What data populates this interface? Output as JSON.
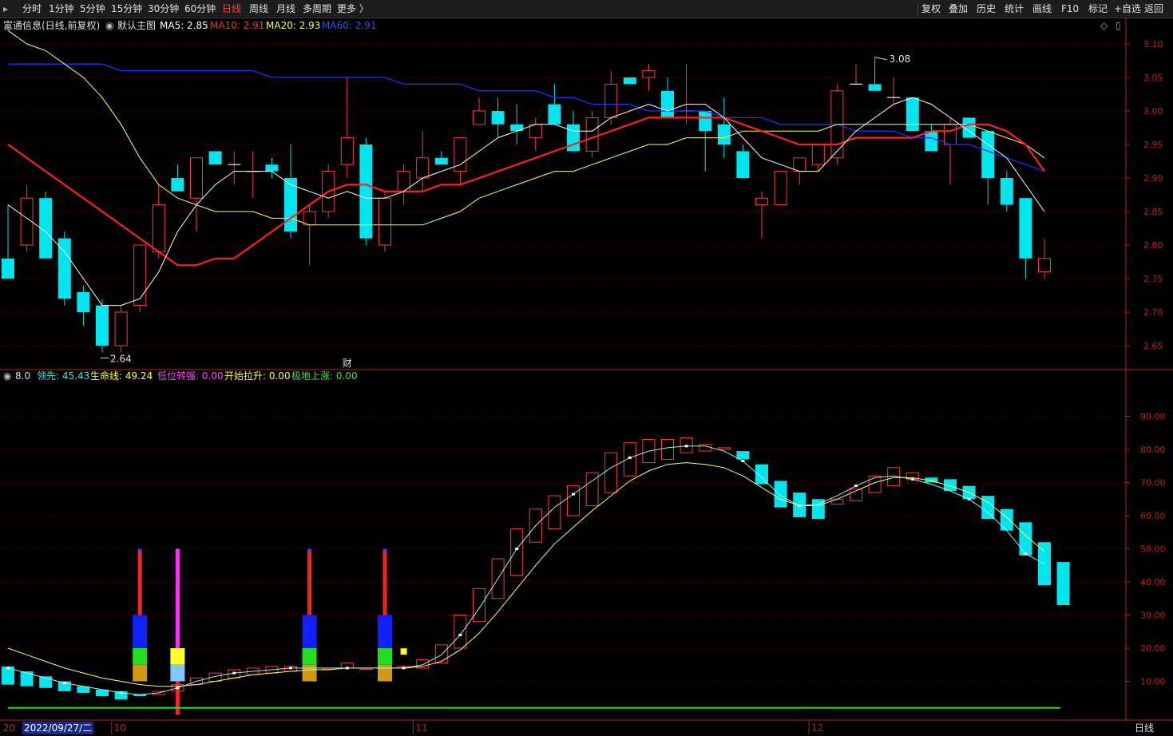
{
  "toolbar": {
    "left": [
      "分时",
      "1分钟",
      "5分钟",
      "15分钟",
      "30分钟",
      "60分钟",
      "日线",
      "周线",
      "月线",
      "多周期",
      "更多 〉"
    ],
    "active": "日线",
    "right": [
      "复权",
      "叠加",
      "历史",
      "统计",
      "画线",
      "F10",
      "标记",
      "+自选",
      "返回"
    ]
  },
  "main_header": {
    "stock": "富通信息(日线,前复权)",
    "indicator": "默认主图",
    "ma5": "MA5: 2.85",
    "ma10": "MA10: 2.91",
    "ma20": "MA20: 2.93",
    "ma60": "MA60: 2.91"
  },
  "sub_header": {
    "param": "8.0",
    "lead": "领先: 45.43",
    "life": "生命线: 49.24",
    "low_strong": "低位转强: 0.00",
    "pull_up": "开始拉升: 0.00",
    "extreme_rise": "极地上涨: 0.00"
  },
  "annotations": {
    "high": "3.08",
    "low": "2.64",
    "finance": "财"
  },
  "x_axis": {
    "date_box": "2022/09/27/二",
    "prefix": "20",
    "months": [
      {
        "label": "10",
        "i": 6
      },
      {
        "label": "11",
        "i": 22
      },
      {
        "label": "12",
        "i": 43
      }
    ],
    "period_label": "日线"
  },
  "colors": {
    "up": "#ff3b3b",
    "down": "#00e5ee",
    "ma5": "#ffffff",
    "ma10": "#ff2020",
    "ma20": "#ffff60",
    "ma60": "#2030ff",
    "grid": "#7a0000",
    "axis": "#c02020"
  },
  "chart_data": [
    {
      "type": "candlestick",
      "title": "富通信息(日线,前复权)",
      "y_ticks": [
        "3.10",
        "3.05",
        "3.00",
        "2.95",
        "2.90",
        "2.85",
        "2.80",
        "2.75",
        "2.70",
        "2.65"
      ],
      "ylim": [
        2.625,
        3.125
      ],
      "candles": [
        {
          "o": 2.78,
          "h": 2.86,
          "l": 2.76,
          "c": 2.75
        },
        {
          "o": 2.8,
          "h": 2.89,
          "l": 2.79,
          "c": 2.87
        },
        {
          "o": 2.87,
          "h": 2.88,
          "l": 2.78,
          "c": 2.78
        },
        {
          "o": 2.81,
          "h": 2.82,
          "l": 2.71,
          "c": 2.72
        },
        {
          "o": 2.73,
          "h": 2.74,
          "l": 2.68,
          "c": 2.7
        },
        {
          "o": 2.71,
          "h": 2.72,
          "l": 2.64,
          "c": 2.65
        },
        {
          "o": 2.65,
          "h": 2.71,
          "l": 2.64,
          "c": 2.7
        },
        {
          "o": 2.71,
          "h": 2.8,
          "l": 2.7,
          "c": 2.8
        },
        {
          "o": 2.79,
          "h": 2.89,
          "l": 2.78,
          "c": 2.86
        },
        {
          "o": 2.9,
          "h": 2.92,
          "l": 2.88,
          "c": 2.88
        },
        {
          "o": 2.87,
          "h": 2.93,
          "l": 2.82,
          "c": 2.93
        },
        {
          "o": 2.94,
          "h": 2.94,
          "l": 2.92,
          "c": 2.92
        },
        {
          "o": 2.92,
          "h": 2.94,
          "l": 2.89,
          "c": 2.92
        },
        {
          "o": 2.91,
          "h": 2.94,
          "l": 2.87,
          "c": 2.91
        },
        {
          "o": 2.92,
          "h": 2.93,
          "l": 2.9,
          "c": 2.91
        },
        {
          "o": 2.9,
          "h": 2.95,
          "l": 2.81,
          "c": 2.82
        },
        {
          "o": 2.83,
          "h": 2.86,
          "l": 2.77,
          "c": 2.85
        },
        {
          "o": 2.85,
          "h": 2.92,
          "l": 2.84,
          "c": 2.91
        },
        {
          "o": 2.92,
          "h": 3.05,
          "l": 2.9,
          "c": 2.96
        },
        {
          "o": 2.95,
          "h": 2.96,
          "l": 2.8,
          "c": 2.81
        },
        {
          "o": 2.8,
          "h": 2.88,
          "l": 2.79,
          "c": 2.87
        },
        {
          "o": 2.88,
          "h": 2.92,
          "l": 2.86,
          "c": 2.91
        },
        {
          "o": 2.9,
          "h": 2.97,
          "l": 2.88,
          "c": 2.93
        },
        {
          "o": 2.93,
          "h": 2.94,
          "l": 2.92,
          "c": 2.92
        },
        {
          "o": 2.91,
          "h": 2.96,
          "l": 2.89,
          "c": 2.96
        },
        {
          "o": 2.98,
          "h": 3.02,
          "l": 2.98,
          "c": 3.0
        },
        {
          "o": 3.0,
          "h": 3.02,
          "l": 2.96,
          "c": 2.98
        },
        {
          "o": 2.98,
          "h": 3.01,
          "l": 2.95,
          "c": 2.97
        },
        {
          "o": 2.96,
          "h": 2.99,
          "l": 2.94,
          "c": 2.98
        },
        {
          "o": 3.01,
          "h": 3.04,
          "l": 2.98,
          "c": 2.98
        },
        {
          "o": 2.98,
          "h": 3.0,
          "l": 2.94,
          "c": 2.94
        },
        {
          "o": 2.94,
          "h": 3.0,
          "l": 2.93,
          "c": 2.99
        },
        {
          "o": 2.99,
          "h": 3.06,
          "l": 2.98,
          "c": 3.04
        },
        {
          "o": 3.05,
          "h": 3.05,
          "l": 3.04,
          "c": 3.04
        },
        {
          "o": 3.05,
          "h": 3.07,
          "l": 3.03,
          "c": 3.06
        },
        {
          "o": 3.03,
          "h": 3.05,
          "l": 2.99,
          "c": 2.99
        },
        {
          "o": 3.0,
          "h": 3.07,
          "l": 2.98,
          "c": 3.0
        },
        {
          "o": 3.0,
          "h": 3.0,
          "l": 2.91,
          "c": 2.97
        },
        {
          "o": 2.98,
          "h": 3.02,
          "l": 2.93,
          "c": 2.95
        },
        {
          "o": 2.94,
          "h": 2.95,
          "l": 2.9,
          "c": 2.9
        },
        {
          "o": 2.86,
          "h": 2.88,
          "l": 2.81,
          "c": 2.87
        },
        {
          "o": 2.86,
          "h": 2.91,
          "l": 2.86,
          "c": 2.91
        },
        {
          "o": 2.91,
          "h": 2.93,
          "l": 2.89,
          "c": 2.93
        },
        {
          "o": 2.92,
          "h": 2.95,
          "l": 2.91,
          "c": 2.95
        },
        {
          "o": 2.93,
          "h": 3.04,
          "l": 2.92,
          "c": 3.03
        },
        {
          "o": 3.04,
          "h": 3.07,
          "l": 3.04,
          "c": 3.04
        },
        {
          "o": 3.04,
          "h": 3.08,
          "l": 3.03,
          "c": 3.03
        },
        {
          "o": 3.02,
          "h": 3.05,
          "l": 3.01,
          "c": 3.02
        },
        {
          "o": 3.02,
          "h": 3.02,
          "l": 2.97,
          "c": 2.97
        },
        {
          "o": 2.97,
          "h": 2.98,
          "l": 2.94,
          "c": 2.94
        },
        {
          "o": 2.95,
          "h": 2.99,
          "l": 2.89,
          "c": 2.98
        },
        {
          "o": 2.99,
          "h": 2.99,
          "l": 2.96,
          "c": 2.96
        },
        {
          "o": 2.97,
          "h": 2.97,
          "l": 2.86,
          "c": 2.9
        },
        {
          "o": 2.9,
          "h": 2.91,
          "l": 2.85,
          "c": 2.86
        },
        {
          "o": 2.87,
          "h": 2.87,
          "l": 2.75,
          "c": 2.78
        },
        {
          "o": 2.76,
          "h": 2.81,
          "l": 2.75,
          "c": 2.78
        }
      ],
      "ma5": [
        2.86,
        2.84,
        2.82,
        2.79,
        2.75,
        2.71,
        2.71,
        2.72,
        2.76,
        2.82,
        2.86,
        2.89,
        2.91,
        2.91,
        2.91,
        2.89,
        2.88,
        2.87,
        2.88,
        2.87,
        2.87,
        2.88,
        2.9,
        2.91,
        2.92,
        2.94,
        2.96,
        2.97,
        2.98,
        2.98,
        2.97,
        2.97,
        2.99,
        3.0,
        3.01,
        3.0,
        3.01,
        3.01,
        2.99,
        2.96,
        2.93,
        2.92,
        2.91,
        2.91,
        2.94,
        2.97,
        2.99,
        3.01,
        3.02,
        3.01,
        2.99,
        2.97,
        2.95,
        2.93,
        2.89,
        2.85
      ],
      "ma10": [
        2.95,
        2.93,
        2.91,
        2.89,
        2.87,
        2.85,
        2.83,
        2.81,
        2.79,
        2.77,
        2.77,
        2.78,
        2.78,
        2.8,
        2.82,
        2.84,
        2.86,
        2.88,
        2.89,
        2.89,
        2.88,
        2.88,
        2.88,
        2.89,
        2.89,
        2.9,
        2.91,
        2.92,
        2.93,
        2.94,
        2.95,
        2.96,
        2.97,
        2.98,
        2.99,
        2.99,
        2.99,
        2.99,
        2.99,
        2.98,
        2.97,
        2.96,
        2.95,
        2.95,
        2.95,
        2.96,
        2.96,
        2.96,
        2.96,
        2.97,
        2.97,
        2.98,
        2.98,
        2.97,
        2.95,
        2.91
      ],
      "ma20": [
        3.12,
        3.1,
        3.09,
        3.07,
        3.05,
        3.02,
        2.98,
        2.93,
        2.89,
        2.87,
        2.86,
        2.85,
        2.85,
        2.85,
        2.84,
        2.84,
        2.83,
        2.83,
        2.83,
        2.83,
        2.83,
        2.83,
        2.83,
        2.84,
        2.85,
        2.87,
        2.88,
        2.89,
        2.9,
        2.91,
        2.91,
        2.92,
        2.93,
        2.94,
        2.95,
        2.95,
        2.96,
        2.96,
        2.96,
        2.97,
        2.97,
        2.97,
        2.97,
        2.97,
        2.98,
        2.98,
        2.98,
        2.98,
        2.98,
        2.98,
        2.98,
        2.98,
        2.97,
        2.96,
        2.95,
        2.93
      ],
      "ma60": [
        3.07,
        3.07,
        3.07,
        3.07,
        3.07,
        3.07,
        3.06,
        3.06,
        3.06,
        3.06,
        3.06,
        3.06,
        3.06,
        3.06,
        3.05,
        3.05,
        3.05,
        3.05,
        3.05,
        3.05,
        3.05,
        3.04,
        3.04,
        3.04,
        3.04,
        3.03,
        3.03,
        3.03,
        3.03,
        3.02,
        3.02,
        3.01,
        3.01,
        3.01,
        3.0,
        3.0,
        3.0,
        3.0,
        2.99,
        2.99,
        2.99,
        2.98,
        2.98,
        2.98,
        2.98,
        2.97,
        2.97,
        2.97,
        2.96,
        2.96,
        2.95,
        2.95,
        2.94,
        2.93,
        2.92,
        2.91
      ]
    },
    {
      "type": "bar",
      "title": "",
      "y_ticks": [
        "90.00",
        "80.00",
        "70.00",
        "60.00",
        "50.00",
        "40.00",
        "30.00",
        "20.00",
        "10.00"
      ],
      "ylim": [
        0,
        100
      ],
      "bars": [
        {
          "o": 14.5,
          "c": 9.0
        },
        {
          "o": 13.0,
          "c": 8.5
        },
        {
          "o": 11.5,
          "c": 8.0
        },
        {
          "o": 10.0,
          "c": 7.0
        },
        {
          "o": 8.5,
          "c": 6.5
        },
        {
          "o": 7.5,
          "c": 5.5
        },
        {
          "o": 7.0,
          "c": 4.5
        },
        {
          "o": 6.0,
          "c": 5.5
        },
        {
          "o": 6.0,
          "c": 7.0
        },
        {
          "o": 7.0,
          "c": 9.0
        },
        {
          "o": 9.0,
          "c": 11.0
        },
        {
          "o": 10.0,
          "c": 12.5
        },
        {
          "o": 11.0,
          "c": 13.5
        },
        {
          "o": 12.0,
          "c": 14.0
        },
        {
          "o": 12.5,
          "c": 14.5
        },
        {
          "o": 13.0,
          "c": 14.5
        },
        {
          "o": 13.5,
          "c": 14.5
        },
        {
          "o": 14.0,
          "c": 14.0
        },
        {
          "o": 14.0,
          "c": 15.5
        },
        {
          "o": 14.0,
          "c": 14.0
        },
        {
          "o": 14.0,
          "c": 14.5
        },
        {
          "o": 14.0,
          "c": 14.5
        },
        {
          "o": 14.0,
          "c": 16.5
        },
        {
          "o": 15.5,
          "c": 21.0
        },
        {
          "o": 20.0,
          "c": 30.0
        },
        {
          "o": 28.0,
          "c": 38.0
        },
        {
          "o": 35.0,
          "c": 47.0
        },
        {
          "o": 42.0,
          "c": 56.0
        },
        {
          "o": 52.0,
          "c": 62.0
        },
        {
          "o": 56.0,
          "c": 66.0
        },
        {
          "o": 60.0,
          "c": 69.0
        },
        {
          "o": 63.0,
          "c": 73.0
        },
        {
          "o": 67.0,
          "c": 79.0
        },
        {
          "o": 72.0,
          "c": 82.0
        },
        {
          "o": 76.0,
          "c": 83.0
        },
        {
          "o": 77.0,
          "c": 83.0
        },
        {
          "o": 79.0,
          "c": 83.5
        },
        {
          "o": 79.5,
          "c": 81.5
        },
        {
          "o": 80.0,
          "c": 80.5
        },
        {
          "o": 79.5,
          "c": 77.0
        },
        {
          "o": 75.5,
          "c": 69.5
        },
        {
          "o": 70.5,
          "c": 62.5
        },
        {
          "o": 67.0,
          "c": 59.5
        },
        {
          "o": 65.0,
          "c": 59.0
        },
        {
          "o": 63.5,
          "c": 65.0
        },
        {
          "o": 64.5,
          "c": 68.0
        },
        {
          "o": 67.0,
          "c": 72.0
        },
        {
          "o": 69.0,
          "c": 74.5
        },
        {
          "o": 71.0,
          "c": 73.0
        },
        {
          "o": 71.5,
          "c": 70.0
        },
        {
          "o": 71.0,
          "c": 67.5
        },
        {
          "o": 69.0,
          "c": 65.0
        },
        {
          "o": 66.0,
          "c": 59.0
        },
        {
          "o": 62.0,
          "c": 55.5
        },
        {
          "o": 58.0,
          "c": 48.0
        },
        {
          "o": 52.0,
          "c": 39.0
        },
        {
          "o": 46.0,
          "c": 33.0
        }
      ],
      "lead_line": [
        14.0,
        12.5,
        11.0,
        9.5,
        8.5,
        7.5,
        6.5,
        6.0,
        6.5,
        8.0,
        10.0,
        11.5,
        12.5,
        13.0,
        13.5,
        14.0,
        14.0,
        14.0,
        14.0,
        14.0,
        14.0,
        14.0,
        15.0,
        18.0,
        24.0,
        32.0,
        41.0,
        50.0,
        57.0,
        62.5,
        66.5,
        70.5,
        74.5,
        77.5,
        79.5,
        80.5,
        81.0,
        81.0,
        79.5,
        76.5,
        71.5,
        66.0,
        63.0,
        63.5,
        66.0,
        69.0,
        71.5,
        72.0,
        71.0,
        69.5,
        67.5,
        65.0,
        61.0,
        55.5,
        48.5,
        45.4
      ],
      "life_line": [
        20.0,
        18.0,
        16.0,
        14.0,
        12.5,
        11.0,
        10.0,
        9.0,
        8.5,
        8.5,
        9.0,
        10.0,
        11.0,
        12.0,
        12.5,
        13.0,
        13.5,
        13.5,
        14.0,
        14.0,
        14.0,
        14.0,
        14.5,
        16.0,
        19.5,
        24.5,
        31.0,
        38.0,
        45.0,
        51.5,
        56.5,
        61.5,
        66.0,
        70.5,
        73.5,
        75.5,
        76.0,
        75.5,
        74.5,
        72.0,
        68.5,
        65.0,
        63.0,
        63.0,
        65.0,
        67.5,
        70.0,
        71.5,
        71.5,
        70.5,
        69.0,
        67.0,
        64.0,
        59.5,
        54.0,
        49.2
      ],
      "signals": [
        {
          "i": 7,
          "kind": "red"
        },
        {
          "i": 9,
          "kind": "magenta"
        },
        {
          "i": 16,
          "kind": "red"
        },
        {
          "i": 20,
          "kind": "red"
        }
      ],
      "marker": {
        "i": 21,
        "value": 19.0
      },
      "baseline": 2.0
    }
  ]
}
